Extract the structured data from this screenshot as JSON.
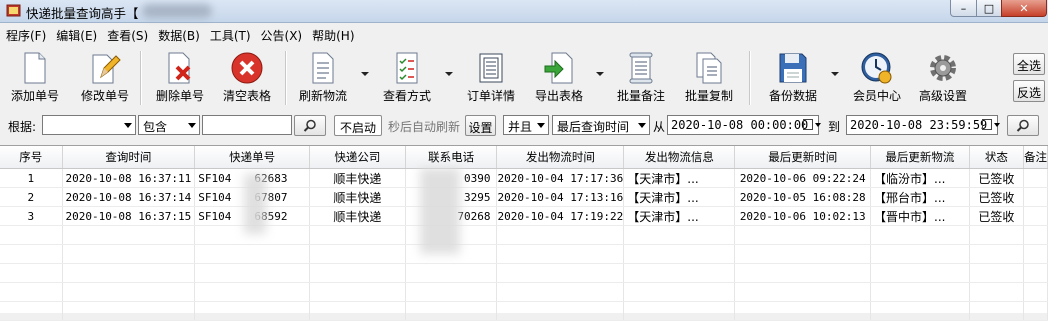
{
  "window": {
    "title": "快递批量查询高手【",
    "minimize_label": "–",
    "maximize_label": "□",
    "close_label": "✕"
  },
  "menu": [
    "程序(F)",
    "编辑(E)",
    "查看(S)",
    "数据(B)",
    "工具(T)",
    "公告(X)",
    "帮助(H)"
  ],
  "toolbar": {
    "buttons": [
      {
        "label": "添加单号",
        "icon": "add-document-icon"
      },
      {
        "label": "修改单号",
        "icon": "edit-document-icon"
      },
      {
        "label": "删除单号",
        "icon": "delete-document-icon"
      },
      {
        "label": "清空表格",
        "icon": "clear-red-x-icon"
      },
      {
        "label": "刷新物流",
        "icon": "refresh-list-icon"
      },
      {
        "label": "查看方式",
        "icon": "checklist-icon"
      },
      {
        "label": "订单详情",
        "icon": "order-detail-icon"
      },
      {
        "label": "导出表格",
        "icon": "export-arrow-icon"
      },
      {
        "label": "批量备注",
        "icon": "scroll-note-icon"
      },
      {
        "label": "批量复制",
        "icon": "copy-documents-icon"
      },
      {
        "label": "备份数据",
        "icon": "floppy-disk-icon"
      },
      {
        "label": "会员中心",
        "icon": "clock-member-icon"
      },
      {
        "label": "高级设置",
        "icon": "gear-icon"
      }
    ],
    "select_all": "全选",
    "invert_select": "反选"
  },
  "filter": {
    "basis_label": "根据:",
    "basis_value": "",
    "match_value": "包含",
    "keyword_value": "",
    "auto_refresh_value": "不启动",
    "auto_refresh_suffix": "秒后自动刷新",
    "settings_button": "设置",
    "logic_value": "并且",
    "date_field_value": "最后查询时间",
    "from_label": "从",
    "from_value": "2020-10-08 00:00:00",
    "to_label": "到",
    "to_value": "2020-10-08 23:59:59"
  },
  "table": {
    "columns": [
      "序号",
      "查询时间",
      "快递单号",
      "快递公司",
      "联系电话",
      "发出物流时间",
      "发出物流信息",
      "最后更新时间",
      "最后更新物流",
      "状态",
      "备注"
    ],
    "rows": [
      [
        "1",
        "2020-10-08 16:37:11",
        "SF104",
        "62683",
        "顺丰快递",
        "0390",
        "2020-10-04 17:17:36",
        "【天津市】...",
        "2020-10-06 09:22:24",
        "【临汾市】...",
        "已签收",
        ""
      ],
      [
        "2",
        "2020-10-08 16:37:14",
        "SF104",
        "67807",
        "顺丰快递",
        "3295",
        "2020-10-04 17:13:16",
        "【天津市】...",
        "2020-10-05 16:08:28",
        "【邢台市】...",
        "已签收",
        ""
      ],
      [
        "3",
        "2020-10-08 16:37:15",
        "SF104",
        "68592",
        "顺丰快递",
        "70268",
        "2020-10-04 17:19:22",
        "【天津市】...",
        "2020-10-06 10:02:13",
        "【晋中市】...",
        "已签收",
        ""
      ]
    ]
  }
}
